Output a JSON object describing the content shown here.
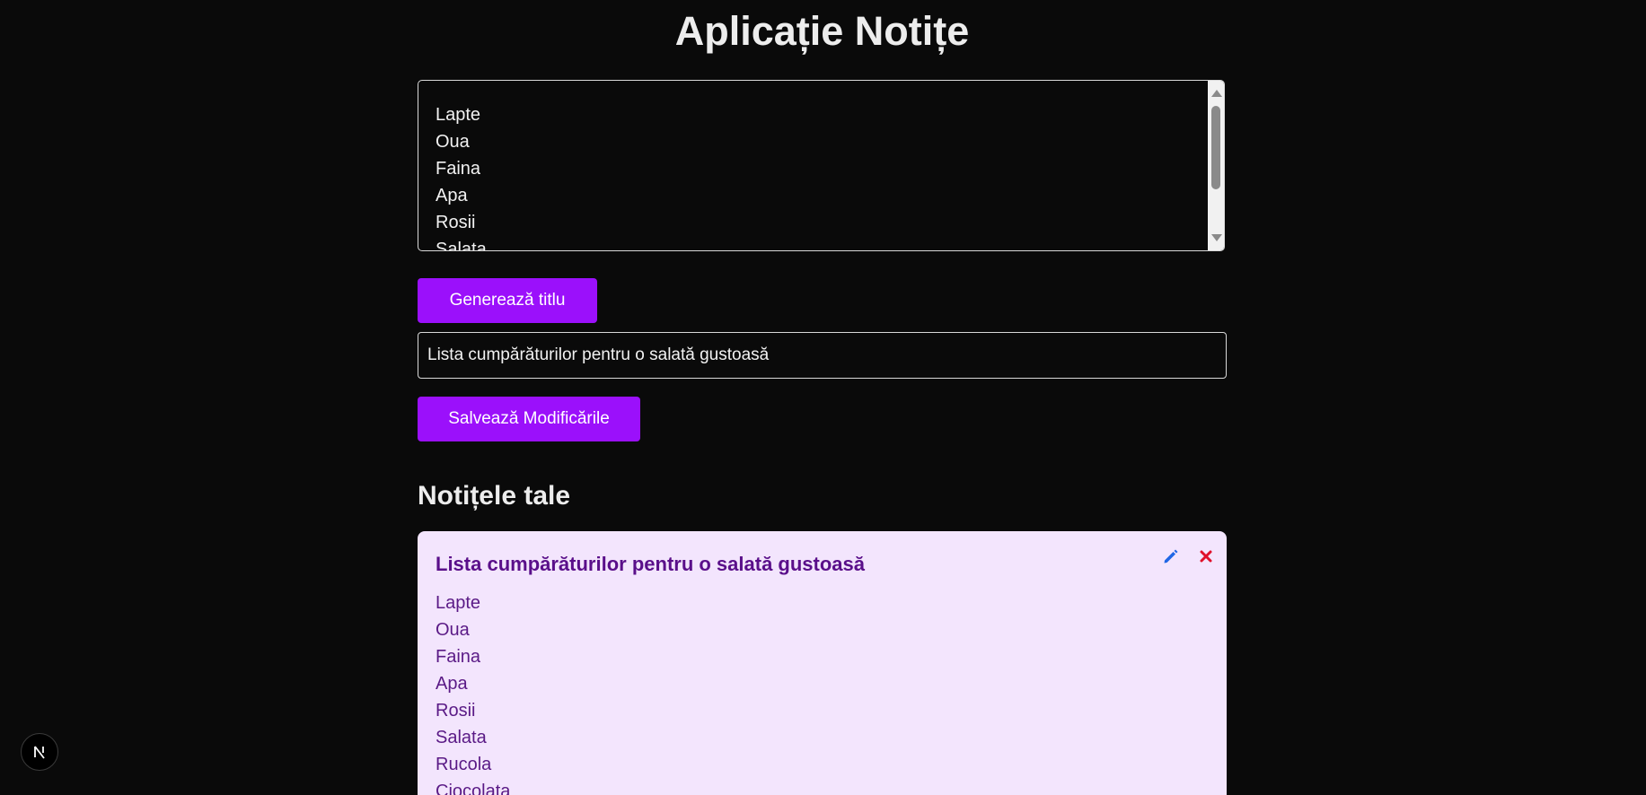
{
  "header": {
    "title": "Aplicație Notițe"
  },
  "editor": {
    "lines": [
      "Lapte",
      "Oua",
      "Faina",
      "Apa",
      "Rosii",
      "Salata"
    ]
  },
  "actions": {
    "generate_label": "Generează titlu",
    "save_label": "Salvează Modificările"
  },
  "title_input": {
    "value": "Lista cumpărăturilor pentru o salată gustoasă"
  },
  "notes_section": {
    "heading": "Notițele tale"
  },
  "notes": [
    {
      "title": "Lista cumpărăturilor pentru o salată gustoasă",
      "lines": [
        "Lapte",
        "Oua",
        "Faina",
        "Apa",
        "Rosii",
        "Salata",
        "Rucola",
        "Ciocolata"
      ]
    }
  ],
  "icons": {
    "edit": "pencil-icon",
    "delete": "close-icon",
    "devtools": "nextjs-logo-icon"
  },
  "colors": {
    "accent": "#9b10fb",
    "background": "#0a0a0a",
    "card": "#f3e5fd",
    "card_text": "#5a0f8a",
    "edit_icon": "#1f66e5",
    "delete_icon": "#e0102a"
  }
}
